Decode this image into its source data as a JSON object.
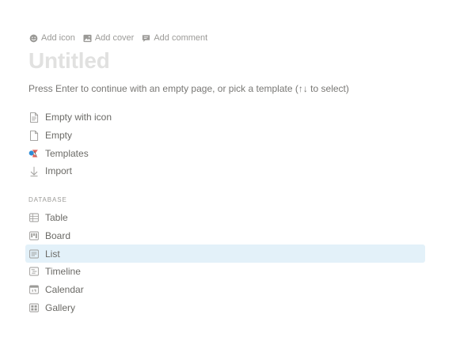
{
  "top_actions": {
    "add_icon": "Add icon",
    "add_cover": "Add cover",
    "add_comment": "Add comment"
  },
  "page": {
    "title_placeholder": "Untitled",
    "hint": "Press Enter to continue with an empty page, or pick a template (↑↓ to select)"
  },
  "templates": {
    "items": [
      {
        "label": "Empty with icon",
        "icon": "page-with-lines-icon"
      },
      {
        "label": "Empty",
        "icon": "blank-page-icon"
      },
      {
        "label": "Templates",
        "icon": "templates-shapes-icon"
      },
      {
        "label": "Import",
        "icon": "arrow-down-import-icon"
      }
    ]
  },
  "database": {
    "section_label": "DATABASE",
    "items": [
      {
        "label": "Table",
        "icon": "table-icon"
      },
      {
        "label": "Board",
        "icon": "board-icon"
      },
      {
        "label": "List",
        "icon": "list-icon",
        "selected": true
      },
      {
        "label": "Timeline",
        "icon": "timeline-icon"
      },
      {
        "label": "Calendar",
        "icon": "calendar-icon"
      },
      {
        "label": "Gallery",
        "icon": "gallery-icon"
      }
    ]
  },
  "colors": {
    "selected_row": "#e3f1f9",
    "muted_text": "#9b9a97",
    "title_placeholder": "#e1e1e0",
    "template_icon_red": "#e16259",
    "template_icon_blue": "#2d8cd6"
  }
}
